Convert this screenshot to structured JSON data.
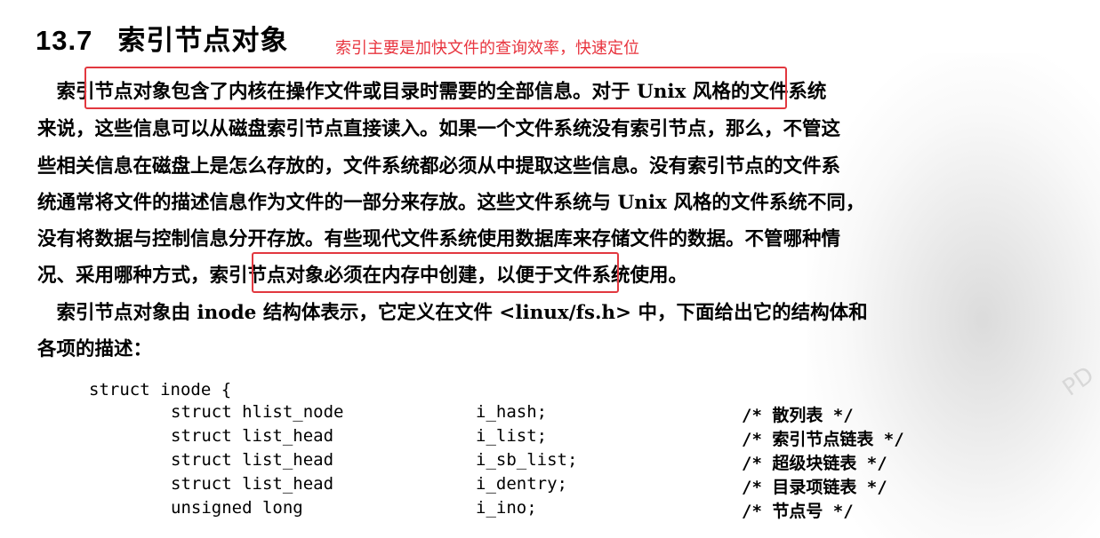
{
  "heading": {
    "number": "13.7",
    "title": "索引节点对象"
  },
  "annotation_note": "索引主要是加快文件的查询效率，快速定位",
  "paragraph_lines": [
    "　索引节点对象包含了内核在操作文件或目录时需要的全部信息。对于 Unix 风格的文件系统",
    "来说，这些信息可以从磁盘索引节点直接读入。如果一个文件系统没有索引节点，那么，不管这",
    "些相关信息在磁盘上是怎么存放的，文件系统都必须从中提取这些信息。没有索引节点的文件系",
    "统通常将文件的描述信息作为文件的一部分来存放。这些文件系统与 Unix 风格的文件系统不同，",
    "没有将数据与控制信息分开存放。有些现代文件系统使用数据库来存储文件的数据。不管哪种情",
    "况、采用哪种方式，索引节点对象必须在内存中创建，以便于文件系统使用。",
    "　索引节点对象由 inode 结构体表示，它定义在文件 <linux/fs.h> 中，下面给出它的结构体和",
    "各项的描述："
  ],
  "code": {
    "header": "struct inode {",
    "fields": [
      {
        "type": "struct hlist_node",
        "name": "i_hash;",
        "comment": "/* 散列表 */"
      },
      {
        "type": "struct list_head",
        "name": "i_list;",
        "comment": "/* 索引节点链表 */"
      },
      {
        "type": "struct list_head",
        "name": "i_sb_list;",
        "comment": "/* 超级块链表 */"
      },
      {
        "type": "struct list_head",
        "name": "i_dentry;",
        "comment": "/* 目录项链表 */"
      },
      {
        "type": "unsigned long",
        "name": "i_ino;",
        "comment": "/* 节点号 */"
      }
    ]
  },
  "watermark_text": "PD",
  "colors": {
    "highlight_box": "#e2383f",
    "note_text": "#e8343e"
  }
}
